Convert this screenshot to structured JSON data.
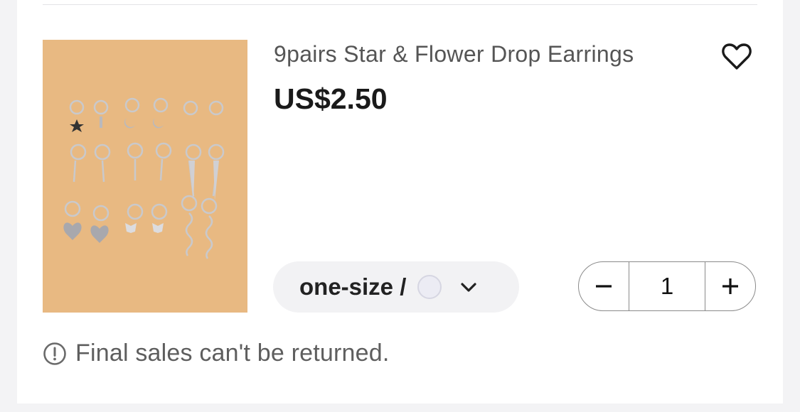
{
  "product": {
    "title": "9pairs Star & Flower Drop Earrings",
    "price": "US$2.50",
    "image_icon": "earrings-product-photo",
    "background_color": "#e8b982"
  },
  "variant": {
    "label": "one-size /",
    "swatch_color": "#ececf4",
    "icon": "chevron-down-icon"
  },
  "quantity": {
    "value": "1",
    "minus_icon": "minus-icon",
    "plus_icon": "plus-icon"
  },
  "notice": {
    "icon": "info-circle-icon",
    "text": "Final sales can't be returned."
  },
  "actions": {
    "wishlist_icon": "heart-outline-icon"
  }
}
